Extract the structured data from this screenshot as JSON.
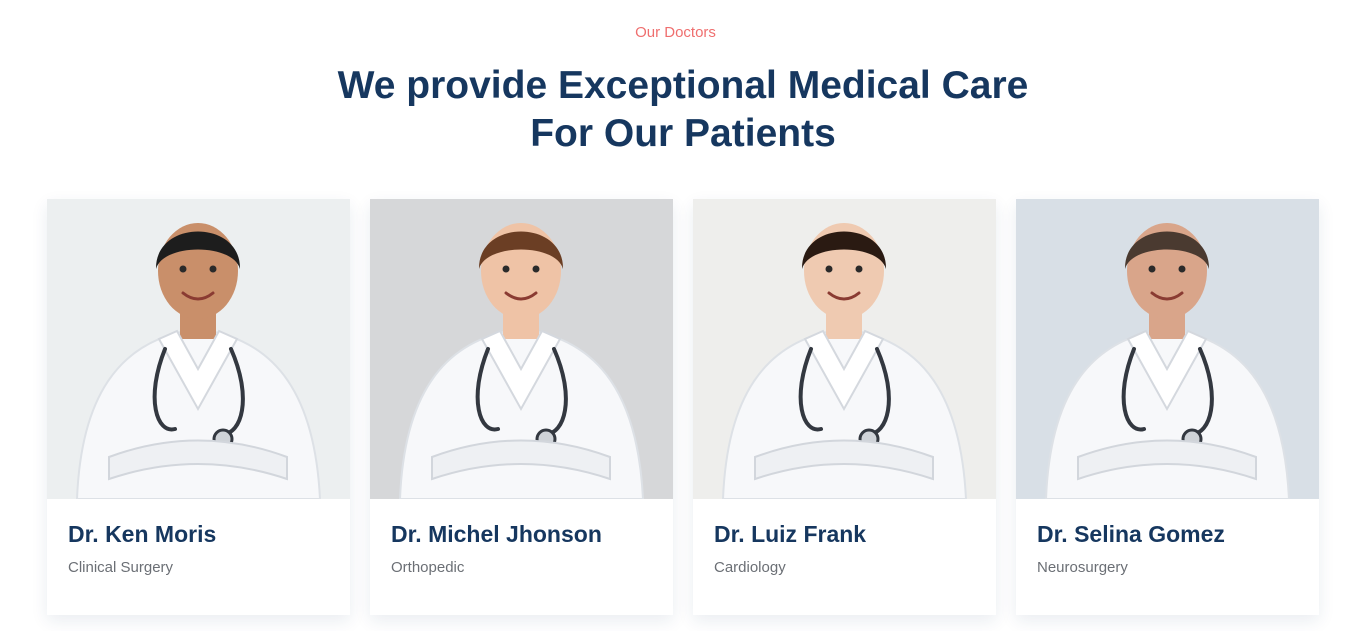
{
  "section": {
    "eyebrow": "Our Doctors",
    "heading": "We provide Exceptional Medical Care For Our Patients"
  },
  "doctors": [
    {
      "name": "Dr. Ken Moris",
      "specialty": "Clinical Surgery",
      "photo_bg": "#eceff0",
      "skin": "#c98f6a",
      "hair": "#1d1d1d"
    },
    {
      "name": "Dr. Michel Jhonson",
      "specialty": "Orthopedic",
      "photo_bg": "#d6d7d9",
      "skin": "#efc3a6",
      "hair": "#6b3e24"
    },
    {
      "name": "Dr. Luiz Frank",
      "specialty": "Cardiology",
      "photo_bg": "#eeeeec",
      "skin": "#efcab1",
      "hair": "#2a1a12"
    },
    {
      "name": "Dr. Selina Gomez",
      "specialty": "Neurosurgery",
      "photo_bg": "#d8dfe6",
      "skin": "#d9a58a",
      "hair": "#4a3a30"
    }
  ],
  "colors": {
    "eyebrow": "#ef6f6f",
    "heading": "#16375f",
    "coat": "#f7f8fa"
  }
}
